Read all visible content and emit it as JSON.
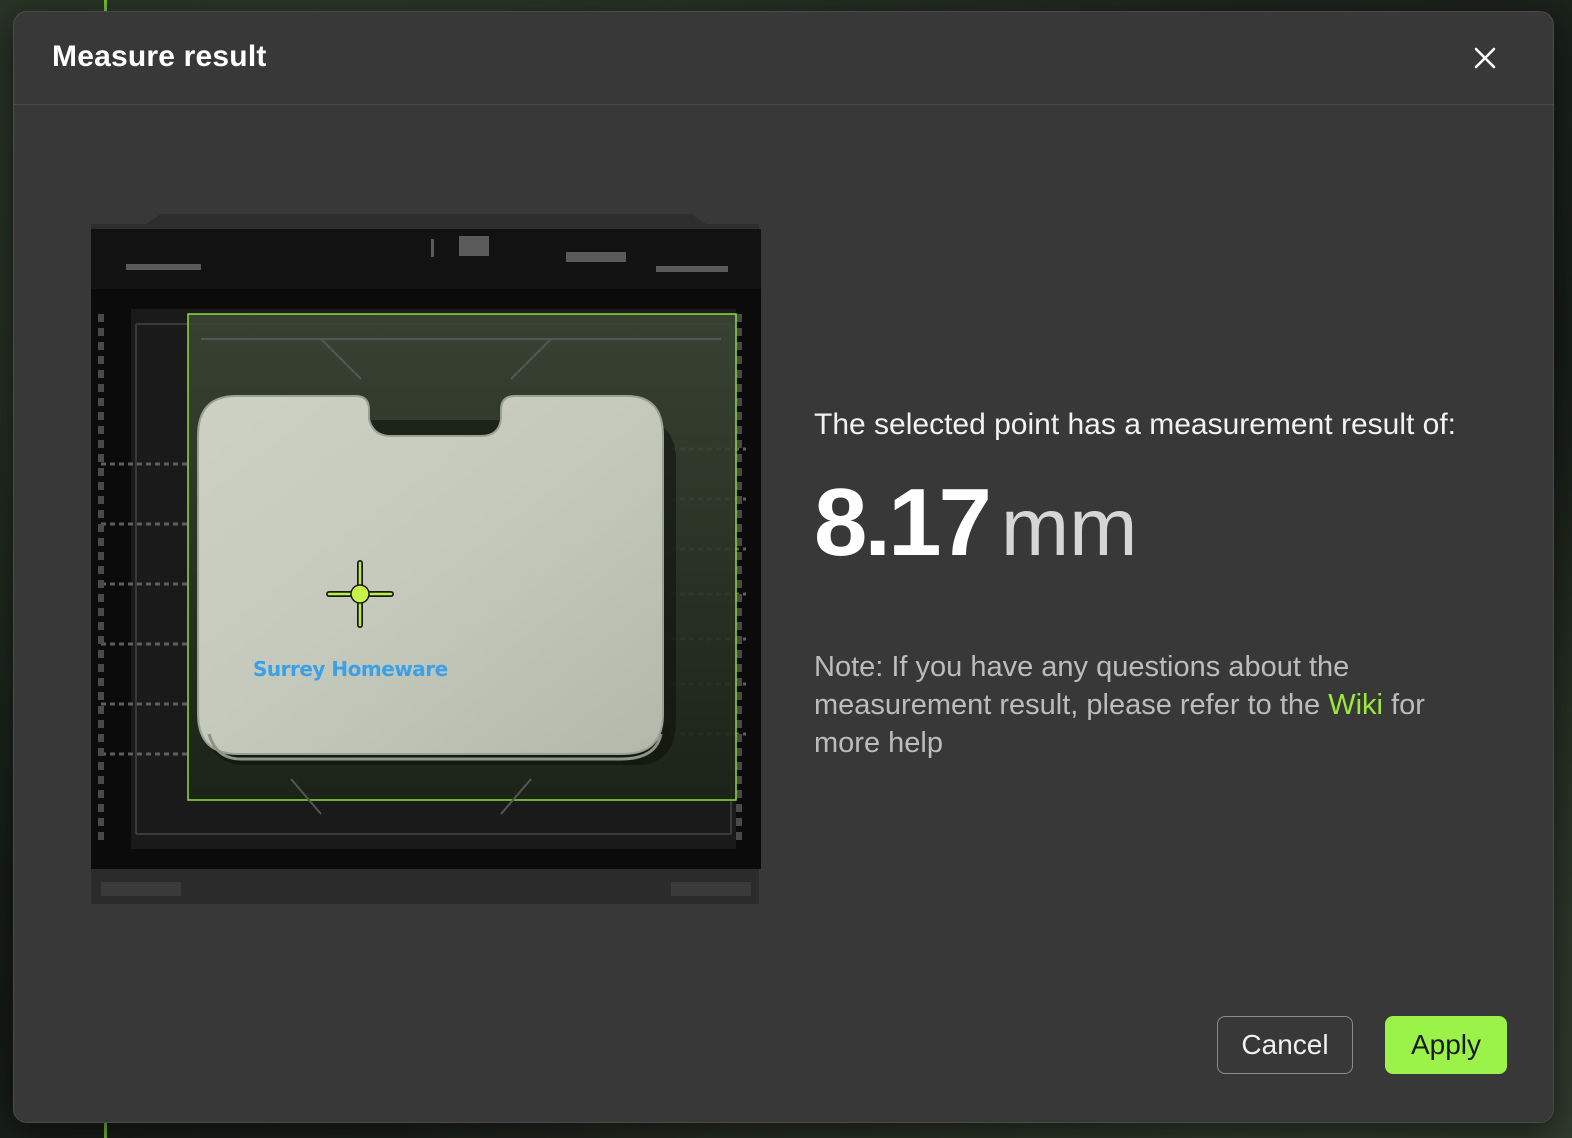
{
  "dialog": {
    "title": "Measure result",
    "close_icon": "close-icon"
  },
  "preview": {
    "label_text": "Surrey Homeware",
    "crosshair_icon": "crosshair-icon",
    "accent_color": "#9bea3b",
    "label_color": "#3aa0e8"
  },
  "result": {
    "label": "The selected point has a measurement result of:",
    "value": "8.17",
    "unit": "mm"
  },
  "note": {
    "prefix": "Note: If you have any questions about the measurement result, please refer to the",
    "link_text": "Wiki",
    "suffix": "for more help"
  },
  "actions": {
    "cancel_label": "Cancel",
    "apply_label": "Apply",
    "apply_color": "#9bf34a"
  }
}
